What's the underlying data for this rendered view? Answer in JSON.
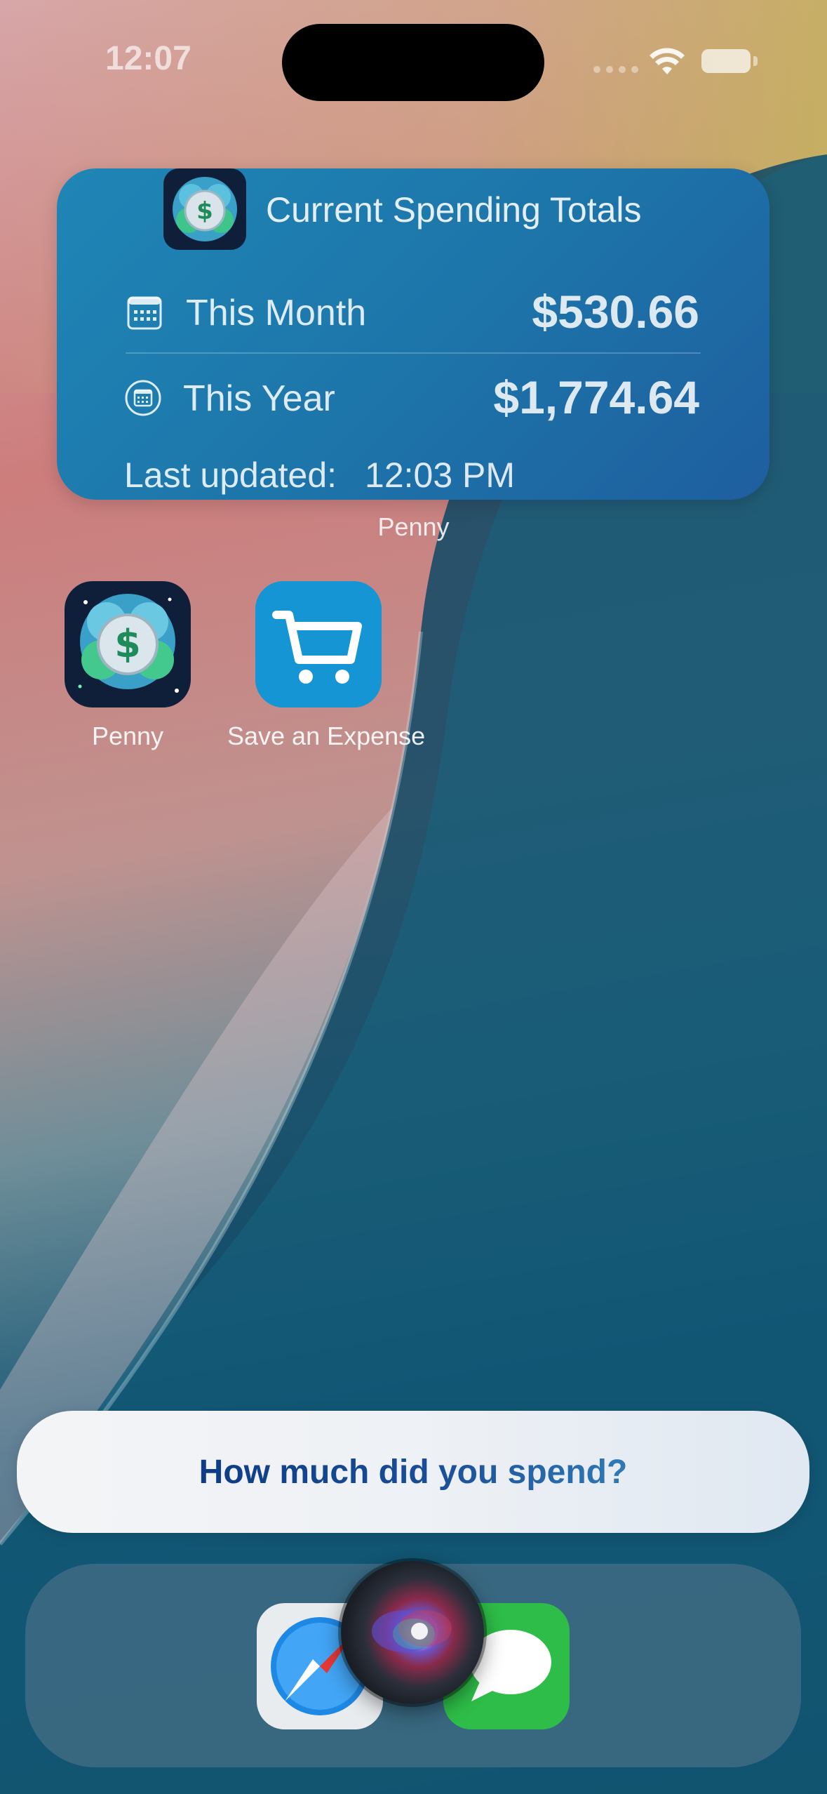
{
  "status_bar": {
    "time": "12:07"
  },
  "widget": {
    "title": "Current Spending Totals",
    "rows": [
      {
        "label": "This Month",
        "value": "$530.66",
        "icon": "calendar-icon"
      },
      {
        "label": "This Year",
        "value": "$1,774.64",
        "icon": "calendar-circle-icon"
      }
    ],
    "updated_label": "Last updated:",
    "updated_time": "12:03 PM",
    "caption": "Penny"
  },
  "apps": [
    {
      "label": "Penny",
      "icon": "penny-brain-dollar-icon"
    },
    {
      "label": "Save an Expense",
      "icon": "shopping-cart-icon"
    }
  ],
  "siri": {
    "prompt": "How much did you spend?"
  },
  "dock": {
    "apps": [
      "safari-icon",
      "messages-icon"
    ]
  },
  "colors": {
    "widget_bg": "#1d74a9",
    "cart_bg": "#1595d3",
    "messages_bg": "#2ebd48",
    "siri_text": "#1a4e98"
  }
}
